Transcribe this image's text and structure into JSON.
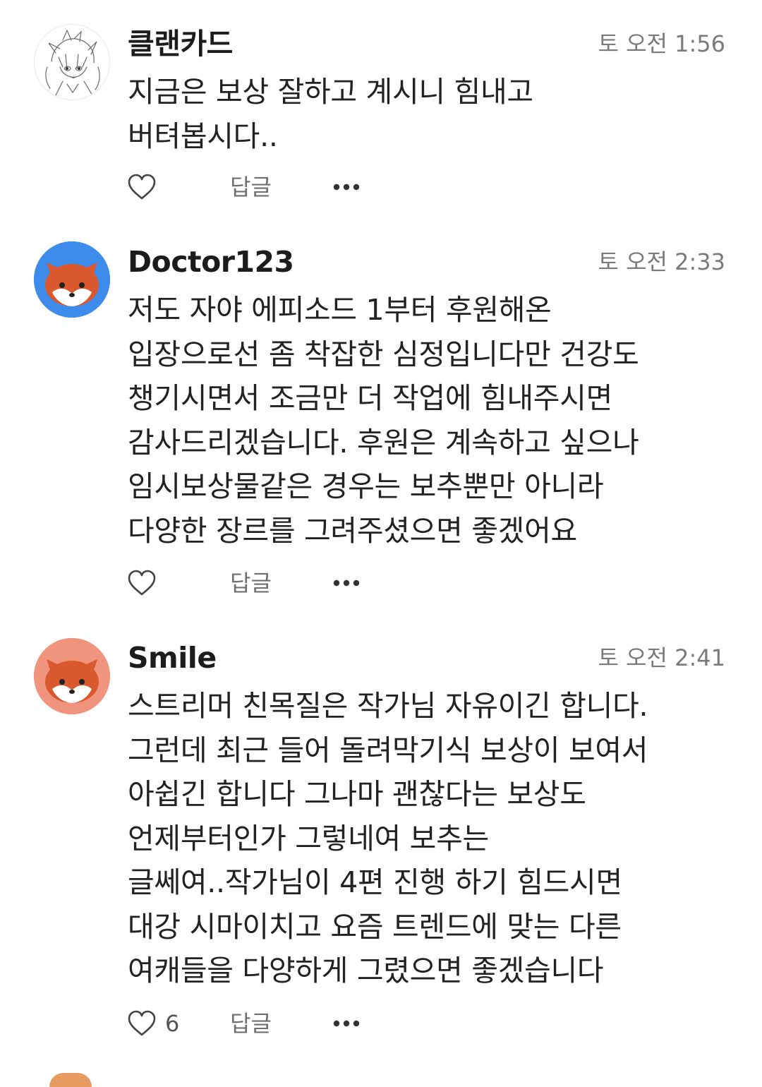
{
  "comments": [
    {
      "author": "클랜카드",
      "time": "토 오전 1:56",
      "avatar_icon": "anime-sketch-avatar-icon",
      "lines": [
        "지금은 보상 잘하고 계시니 힘내고",
        "버텨봅시다.."
      ],
      "like_count": "",
      "reply_label": "답글"
    },
    {
      "author": "Doctor123",
      "time": "토 오전 2:33",
      "avatar_icon": "fox-avatar-icon",
      "avatar_bg": "#3d8bea",
      "lines": [
        "저도 자야 에피소드 1부터 후원해온",
        "입장으로선 좀 착잡한 심정입니다만 건강도",
        "챙기시면서 조금만 더 작업에 힘내주시면",
        "감사드리겠습니다.  후원은 계속하고 싶으나",
        "임시보상물같은 경우는 보추뿐만 아니라",
        "다양한 장르를 그려주셨으면 좋겠어요"
      ],
      "like_count": "",
      "reply_label": "답글"
    },
    {
      "author": "Smile",
      "time": "토 오전 2:41",
      "avatar_icon": "fox-avatar-icon",
      "avatar_bg": "#f0947e",
      "lines": [
        "스트리머 친목질은 작가님 자유이긴 합니다.",
        "그런데 최근 들어 돌려막기식 보상이 보여서",
        "아쉽긴 합니다 그나마 괜찮다는 보상도",
        "언제부터인가 그렇네여 보추는",
        "글쎄여..작가님이 4편 진행 하기 힘드시면",
        "대강 시마이치고 요즘 트렌드에 맞는 다른",
        "여캐들을 다양하게 그렸으면 좋겠습니다"
      ],
      "like_count": "6",
      "reply_label": "답글"
    }
  ],
  "icons": {
    "like": "heart-outline-icon",
    "more": "more-dots-icon"
  },
  "colors": {
    "time_text": "#7a7a7a",
    "reply_text": "#6f6f6f",
    "fox_orange": "#d9582e"
  }
}
